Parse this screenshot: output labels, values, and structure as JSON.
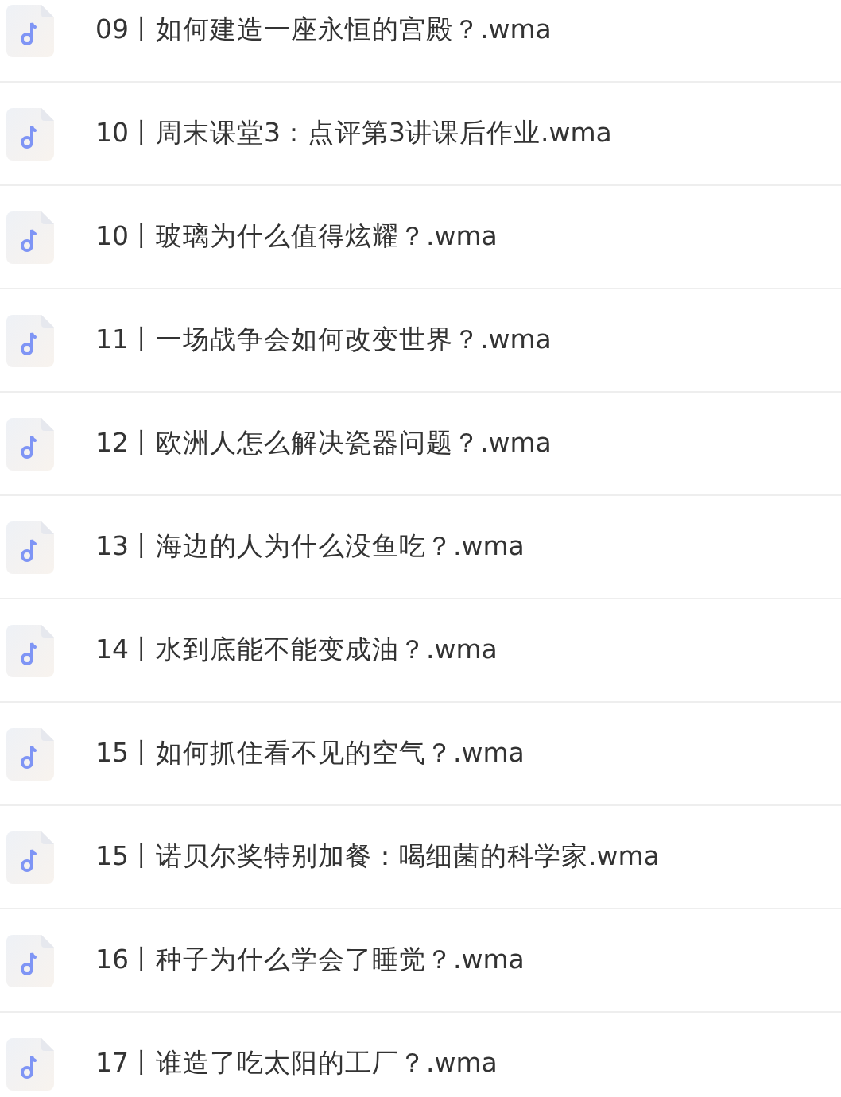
{
  "files": [
    {
      "name": "09丨如何建造一座永恒的宫殿？.wma"
    },
    {
      "name": "10丨周末课堂3：点评第3讲课后作业.wma"
    },
    {
      "name": "10丨玻璃为什么值得炫耀？.wma"
    },
    {
      "name": "11丨一场战争会如何改变世界？.wma"
    },
    {
      "name": "12丨欧洲人怎么解决瓷器问题？.wma"
    },
    {
      "name": "13丨海边的人为什么没鱼吃？.wma"
    },
    {
      "name": "14丨水到底能不能变成油？.wma"
    },
    {
      "name": "15丨如何抓住看不见的空气？.wma"
    },
    {
      "name": "15丨诺贝尔奖特别加餐：喝细菌的科学家.wma"
    },
    {
      "name": "16丨种子为什么学会了睡觉？.wma"
    },
    {
      "name": "17丨谁造了吃太阳的工厂？.wma"
    }
  ]
}
